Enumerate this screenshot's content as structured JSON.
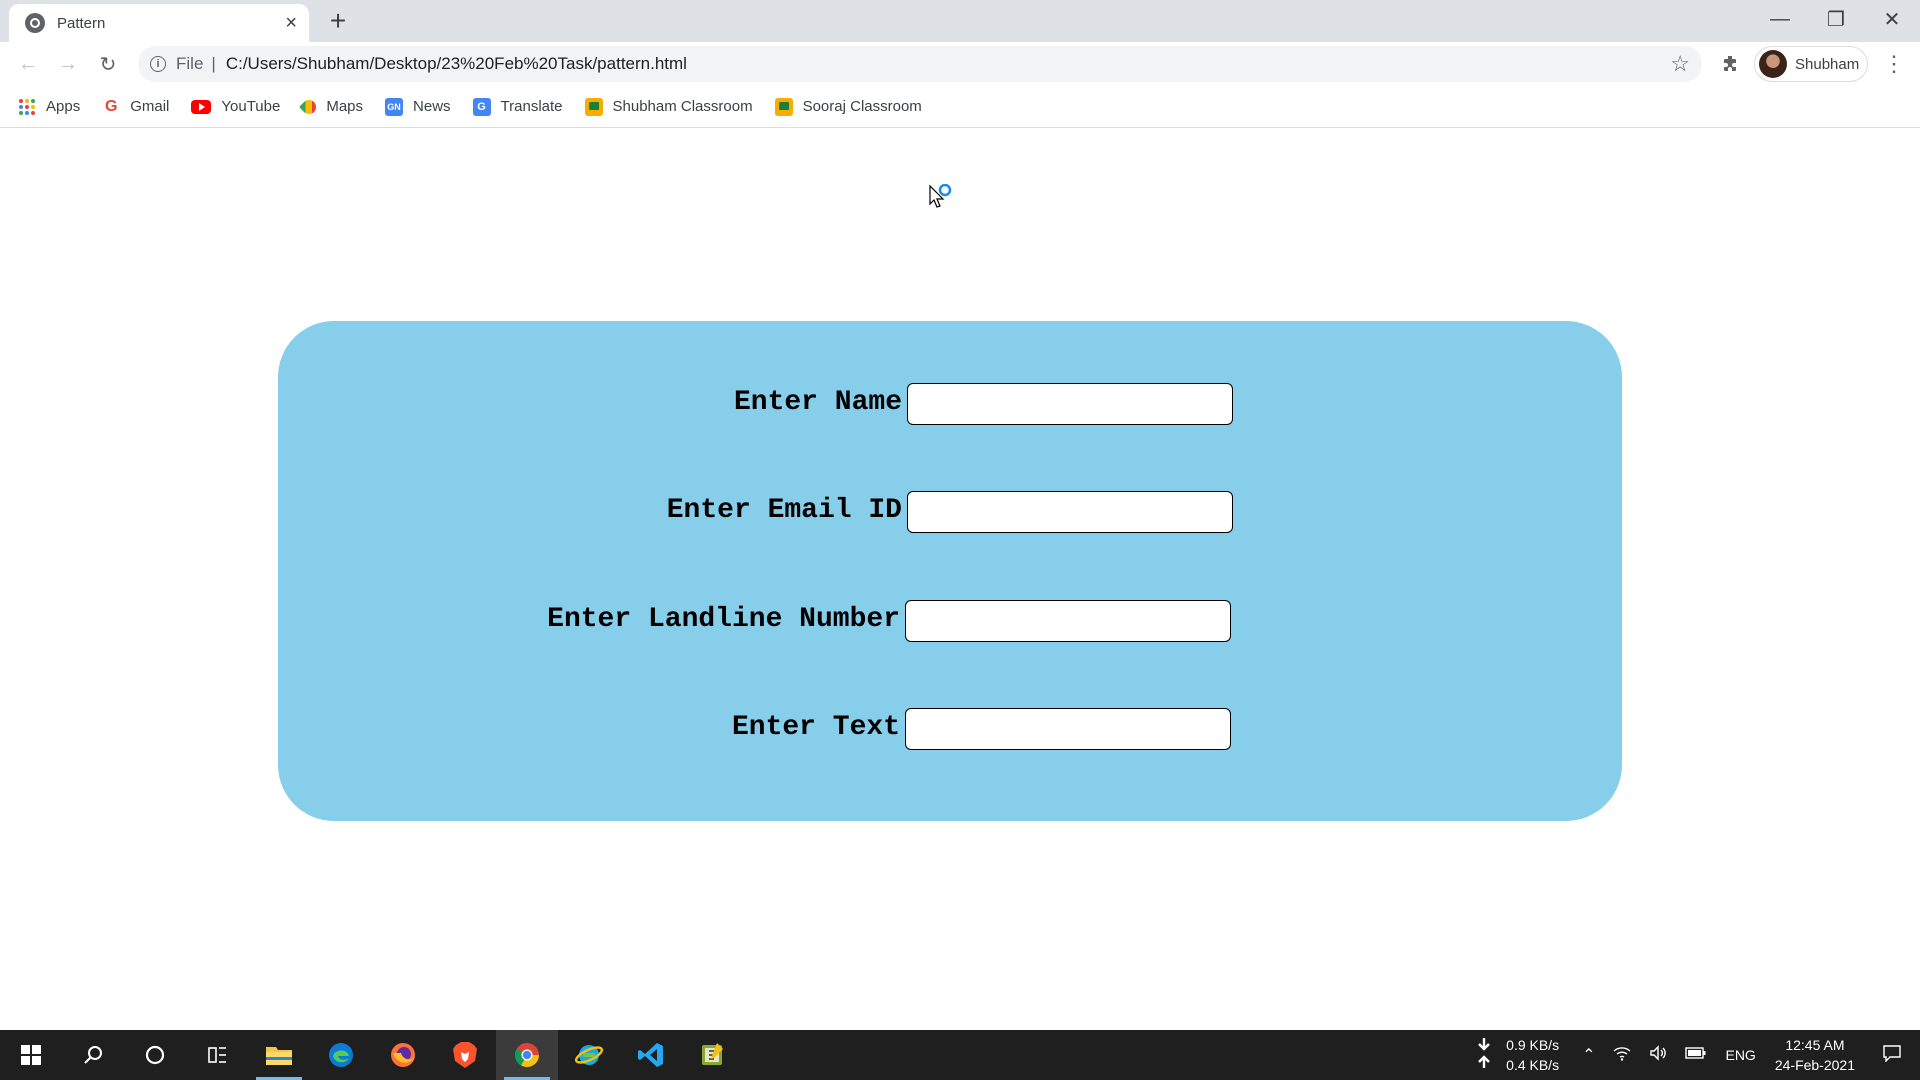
{
  "browser": {
    "tab_title": "Pattern",
    "url_scheme": "File",
    "url": "C:/Users/Shubham/Desktop/23%20Feb%20Task/pattern.html",
    "profile_name": "Shubham"
  },
  "bookmarks": [
    {
      "label": "Apps",
      "icon": "apps-grid-icon"
    },
    {
      "label": "Gmail",
      "icon": "google-icon"
    },
    {
      "label": "YouTube",
      "icon": "youtube-icon"
    },
    {
      "label": "Maps",
      "icon": "maps-icon"
    },
    {
      "label": "News",
      "icon": "news-icon"
    },
    {
      "label": "Translate",
      "icon": "translate-icon"
    },
    {
      "label": "Shubham Classroom",
      "icon": "classroom-icon"
    },
    {
      "label": "Sooraj Classroom",
      "icon": "classroom-icon"
    }
  ],
  "form": {
    "background_color": "#87ceeb",
    "fields": [
      {
        "label": "Enter Name",
        "value": ""
      },
      {
        "label": "Enter Email ID",
        "value": ""
      },
      {
        "label": "Enter Landline Number",
        "value": ""
      },
      {
        "label": "Enter Text",
        "value": ""
      }
    ]
  },
  "taskbar": {
    "apps": [
      "start-icon",
      "search-icon",
      "cortana-icon",
      "task-view-icon",
      "file-explorer-icon",
      "edge-icon",
      "firefox-icon",
      "brave-icon",
      "chrome-icon",
      "ie-icon",
      "vscode-icon",
      "notepad-icon"
    ],
    "net_down": "0.9 KB/s",
    "net_up": "0.4 KB/s",
    "language": "ENG",
    "time": "12:45 AM",
    "date": "24-Feb-2021"
  }
}
